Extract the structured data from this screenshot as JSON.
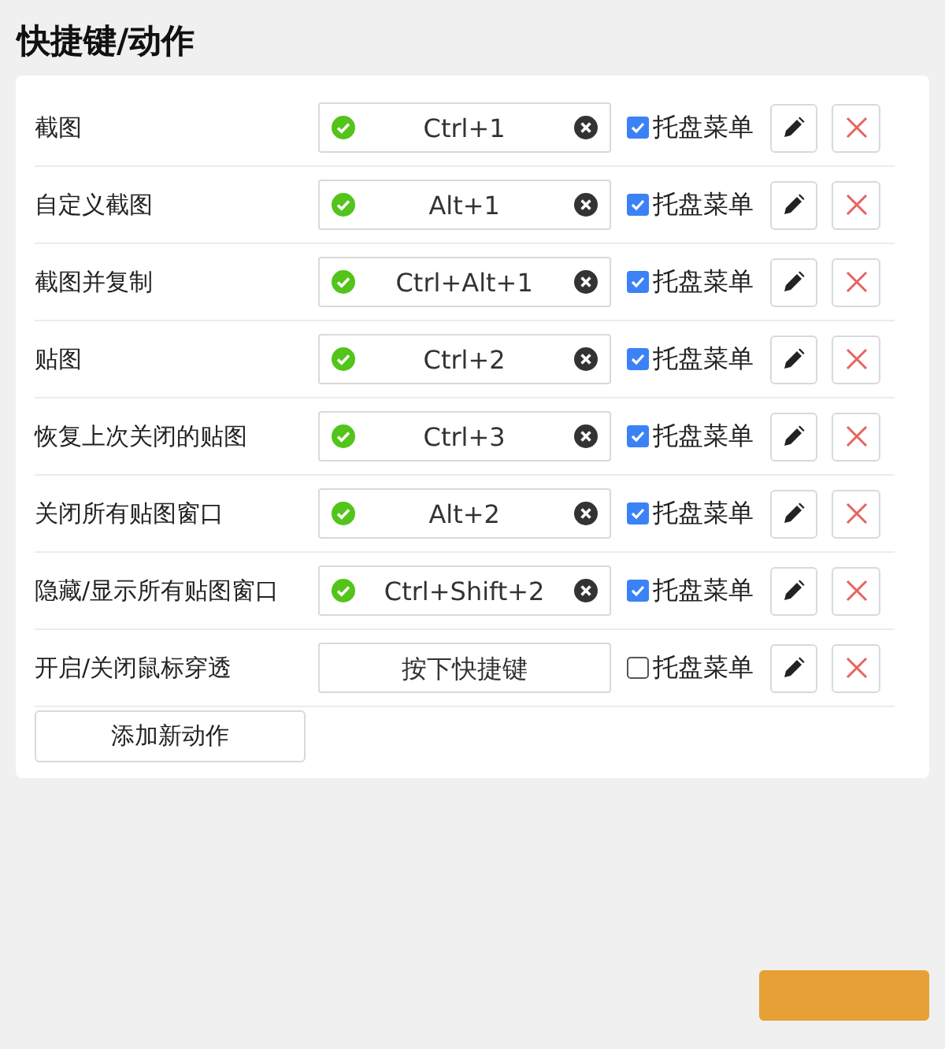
{
  "title": "快捷键/动作",
  "actions": [
    {
      "name": "截图",
      "shortcut": "Ctrl+1",
      "valid": true,
      "tray_menu": true,
      "tray_label": "托盘菜单"
    },
    {
      "name": "自定义截图",
      "shortcut": "Alt+1",
      "valid": true,
      "tray_menu": true,
      "tray_label": "托盘菜单"
    },
    {
      "name": "截图并复制",
      "shortcut": "Ctrl+Alt+1",
      "valid": true,
      "tray_menu": true,
      "tray_label": "托盘菜单"
    },
    {
      "name": "贴图",
      "shortcut": "Ctrl+2",
      "valid": true,
      "tray_menu": true,
      "tray_label": "托盘菜单"
    },
    {
      "name": "恢复上次关闭的贴图",
      "shortcut": "Ctrl+3",
      "valid": true,
      "tray_menu": true,
      "tray_label": "托盘菜单"
    },
    {
      "name": "关闭所有贴图窗口",
      "shortcut": "Alt+2",
      "valid": true,
      "tray_menu": true,
      "tray_label": "托盘菜单"
    },
    {
      "name": "隐藏/显示所有贴图窗口",
      "shortcut": "Ctrl+Shift+2",
      "valid": true,
      "tray_menu": true,
      "tray_label": "托盘菜单"
    },
    {
      "name": "开启/关闭鼠标穿透",
      "placeholder": "按下快捷键",
      "valid": false,
      "tray_menu": false,
      "tray_label": "托盘菜单"
    }
  ],
  "add_button": "添加新动作",
  "footer_button": {
    "kind": "primary"
  }
}
